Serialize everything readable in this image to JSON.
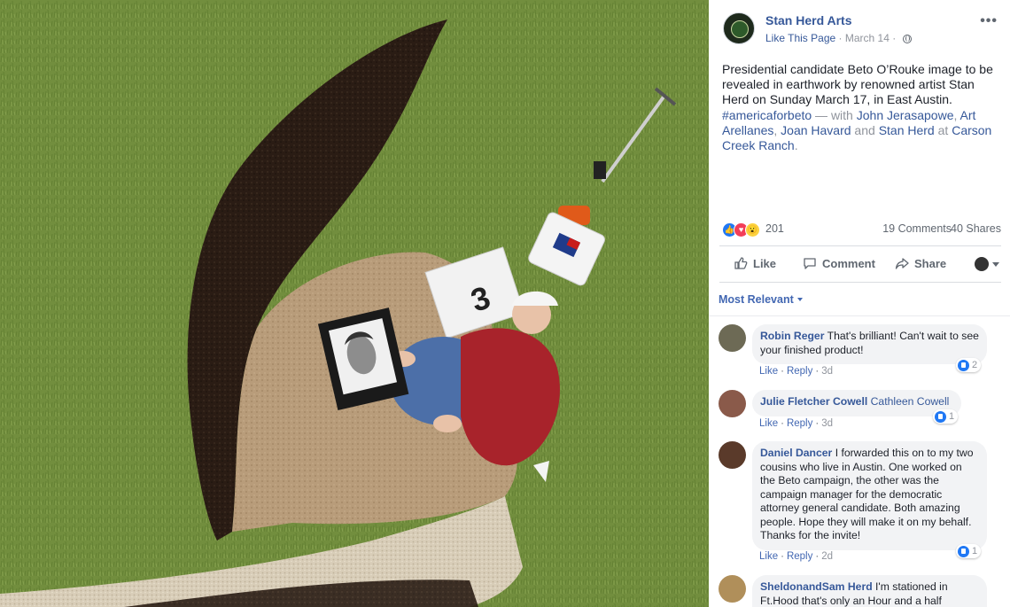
{
  "photo": {
    "description_icon": "earthwork-photo"
  },
  "post": {
    "page_name": "Stan Herd Arts",
    "like_page": "Like This Page",
    "date": "March 14",
    "separator": "·",
    "text_intro": "Presidential candidate Beto O’Rouke image to be revealed in earthwork by renowned artist Stan Herd on Sunday March 17, in East Austin.",
    "hashtag": "#americaforbeto",
    "with": " — with ",
    "tag1": "John Jerasapowe",
    "comma1": ", ",
    "tag2": "Art Arellanes",
    "comma2": ", ",
    "tag3": "Joan Havard",
    "and": " and ",
    "tag4": "Stan Herd",
    "at": " at ",
    "place": "Carson Creek Ranch",
    "period": "."
  },
  "reactions": {
    "count": "201",
    "comments": "19 Comments",
    "shares": "40 Shares",
    "colors": {
      "like": "#2078f4",
      "love": "#f33e58",
      "wow": "#fcd240"
    }
  },
  "actions": {
    "like": "Like",
    "comment": "Comment",
    "share": "Share"
  },
  "sort": {
    "label": "Most Relevant"
  },
  "comments": [
    {
      "name": "Robin Reger",
      "text": "That's brilliant! Can't wait to see your finished product!",
      "like": "Like",
      "reply": "Reply",
      "age": "3d",
      "likes": "2"
    },
    {
      "name": "Julie Fletcher Cowell",
      "tag": "Cathleen Cowell",
      "like": "Like",
      "reply": "Reply",
      "age": "3d",
      "likes": "1"
    },
    {
      "name": "Daniel Dancer",
      "text": "I forwarded this on to my two cousins who live in Austin. One worked on the Beto campaign, the other was the campaign manager for the democratic attorney general candidate. Both amazing people. Hope they will make it on my behalf. Thanks for the invite!",
      "like": "Like",
      "reply": "Reply",
      "age": "2d",
      "likes": "1"
    },
    {
      "name": "SheldonandSam Herd",
      "text": "I'm stationed in Ft.Hood that's only an Hour and a half"
    }
  ]
}
